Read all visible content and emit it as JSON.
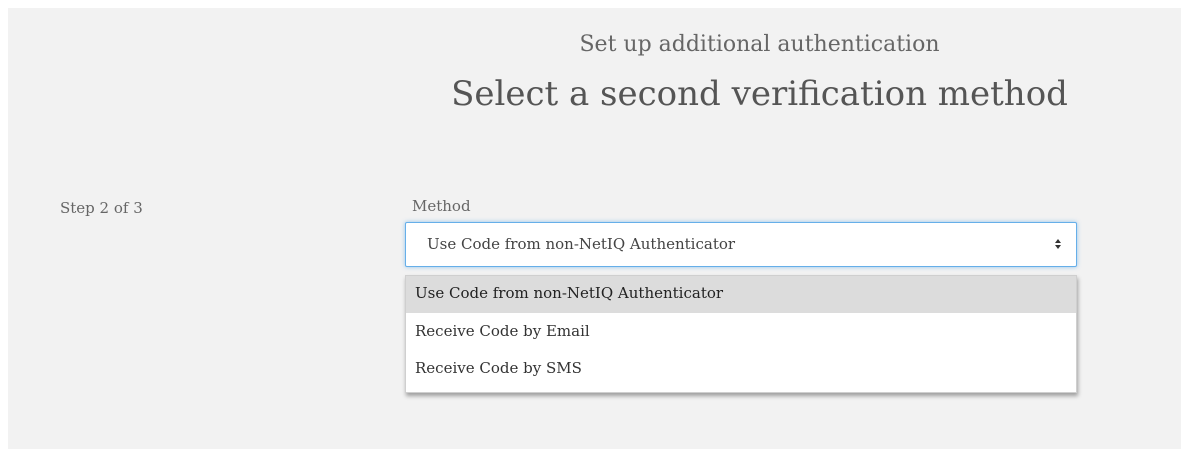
{
  "header": {
    "subtitle": "Set up additional authentication",
    "title": "Select a second verification method"
  },
  "step_indicator": "Step 2 of 3",
  "method": {
    "label": "Method",
    "selected_value": "Use Code from non-NetIQ Authenticator",
    "options": [
      {
        "label": "Use Code from non-NetIQ Authenticator",
        "highlighted": true
      },
      {
        "label": "Receive Code by Email",
        "highlighted": false
      },
      {
        "label": "Receive Code by SMS",
        "highlighted": false
      }
    ]
  },
  "colors": {
    "panel_background": "#f2f2f2",
    "focus_border": "#66afe9",
    "highlight": "#dcdcdc"
  },
  "icons": {
    "select_arrows": "sort-arrows-icon"
  }
}
